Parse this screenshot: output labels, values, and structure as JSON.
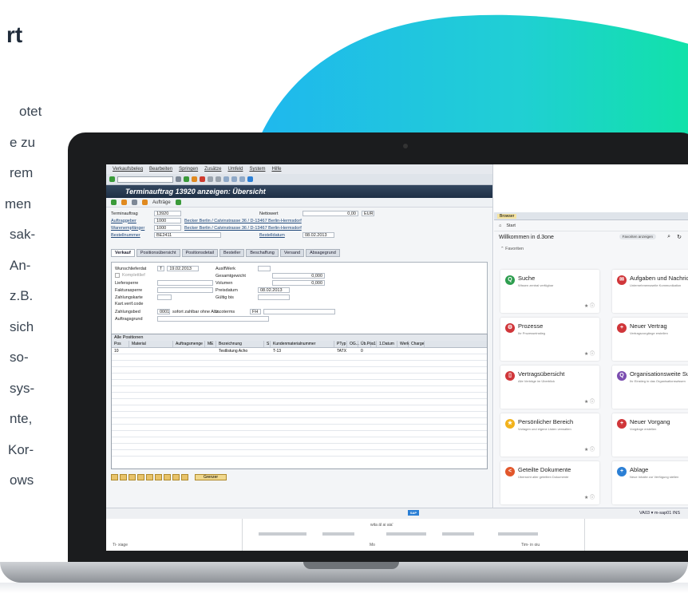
{
  "left_fragments": {
    "heading": "rt",
    "lines": [
      "otet",
      "e zu",
      "rem",
      "men",
      "sak-",
      "An-",
      "z.B.",
      "sich",
      "so-",
      "sys-",
      "nte,",
      "Kor-",
      "ows"
    ]
  },
  "sap": {
    "menu": [
      "Verkaufsbeleg",
      "Bearbeiten",
      "Springen",
      "Zusätze",
      "Umfeld",
      "System",
      "Hilfe"
    ],
    "title": "Terminauftrag 13920 anzeigen: Übersicht",
    "app_toolbar_label": "Aufträge",
    "header": {
      "terminauftrag_label": "Terminauftrag",
      "terminauftrag_value": "13920",
      "nettowert_label": "Nettowert",
      "nettowert_value": "0,00",
      "currency": "EUR",
      "auftraggeber_label": "Auftraggeber",
      "auftraggeber_value": "1000",
      "auftraggeber_name": "Becker Berlin / Calvinstrasse 36 / D-13467 Berlin-Hermsdorf",
      "warenempf_label": "Warenempfänger",
      "warenempf_value": "1000",
      "warenempf_name": "Becker Berlin / Calvinstrasse 36 / D-13467 Berlin-Hermsdorf",
      "bestellnummer_label": "Bestellnummer",
      "bestellnummer_value": "BE2411",
      "bestelldatum_label": "Bestelldatum",
      "bestelldatum_value": "08.02.2013"
    },
    "tabs": [
      "Verkauf",
      "Positionsübersicht",
      "Positionsdetail",
      "Besteller",
      "Beschaffung",
      "Versand",
      "Absagegrund"
    ],
    "verkauf": {
      "wunschlief_label": "Wunschlieferdat",
      "wunschlief_prefix": "T",
      "wunschlief_value": "19.02.2013",
      "komplettlief_label": "Komplettlief",
      "liefersperre_label": "Liefersperre",
      "fakturasperre_label": "Fakturasperre",
      "zahlungskarte_label": "Zahlungskarte",
      "kartverif_label": "Kart.verif.code",
      "zahlungsbed_label": "Zahlungsbed",
      "zahlungsbed_code": "0001",
      "zahlungsbed_text": "sofort zahlbar ohne Abz.",
      "auftragsgrund_label": "Auftragsgrund",
      "auslfwerk_label": "AuslfWerk",
      "gesamtgewicht_label": "Gesamtgewicht",
      "gesamtgewicht_value": "0,000",
      "volumen_label": "Volumen",
      "volumen_value": "0,000",
      "preisdatum_label": "Preisdatum",
      "preisdatum_value": "08.02.2013",
      "gueltig_label": "Gültig bis",
      "incoterms_label": "Incoterms",
      "incoterms_value": "FH"
    },
    "grid": {
      "title": "Alle Positionen",
      "columns": [
        "Pos",
        "Material",
        "Auftragsmenge",
        "ME",
        "Bezeichnung",
        "S",
        "Kundenmaterialnummer",
        "PTyp",
        "OG...",
        "Üb.Pos",
        "1",
        "1.Datum",
        "Werk",
        "Charge"
      ],
      "row": [
        "10",
        "",
        "",
        "",
        "Testlistung Acho",
        "",
        "T-13",
        "TATX",
        "",
        "0",
        "",
        "",
        "",
        ""
      ]
    },
    "bottom_button": "Grenzer",
    "status_right": "VA03 ▾  m-sap01  INS",
    "sap_logo": "SAP"
  },
  "d3": {
    "tabs": [
      "Browser"
    ],
    "nav_label": "Start",
    "welcome": "Willkommen in d.3one",
    "fav_button": "Favoriten anzeigen",
    "section": "Favoriten",
    "cards": [
      {
        "title": "Suche",
        "sub": "Wissen zentral verfügbar",
        "color": "#2e9e4f",
        "glyph": "Q"
      },
      {
        "title": "Aufgaben und Nachrichten",
        "sub": "Unternehmensweite Kommunikation",
        "color": "#d0363a",
        "glyph": "✉"
      },
      {
        "title": "Prozesse",
        "sub": "Ihr Prozesseinstieg",
        "color": "#d0363a",
        "glyph": "⚙"
      },
      {
        "title": "Neuer Vertrag",
        "sub": "Vertragsvorgänge erstellen",
        "color": "#d0363a",
        "glyph": "+"
      },
      {
        "title": "Vertragsübersicht",
        "sub": "Alle Verträge im Überblick",
        "color": "#d0363a",
        "glyph": "▯"
      },
      {
        "title": "Organisationsweite Suche",
        "sub": "Ihr Einstieg in das Organisationswissen",
        "color": "#7b4db0",
        "glyph": "Q"
      },
      {
        "title": "Persönlicher Bereich",
        "sub": "Vorlagen und eigene Listen verwalten",
        "color": "#f2b21b",
        "glyph": "★"
      },
      {
        "title": "Neuer Vorgang",
        "sub": "Vorgänge erstellen",
        "color": "#d0363a",
        "glyph": "+"
      },
      {
        "title": "Geteilte Dokumente",
        "sub": "Übersicht aller geteilten Dokumente",
        "color": "#e2572b",
        "glyph": "<"
      },
      {
        "title": "Ablage",
        "sub": "Neue Inhalte zur Verfügung stellen",
        "color": "#2b7fd5",
        "glyph": "+"
      }
    ]
  },
  "lower": {
    "doc_line": "wita äl ai aia'",
    "labels": [
      "Ti- xiage",
      "Mo",
      "Tim- in oiu"
    ]
  },
  "colors": {
    "wave_start": "#29c5e8",
    "wave_end": "#12e0a8",
    "sap_title": "#1e2f45"
  }
}
